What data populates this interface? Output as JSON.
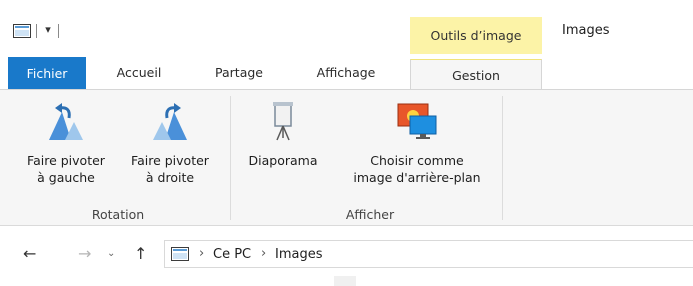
{
  "window": {
    "title": "Images"
  },
  "quick_access": {
    "dropdown_glyph": "▾",
    "icon": "folder-properties-icon"
  },
  "context_group": {
    "label": "Outils d’image",
    "color": "#fcf3a7"
  },
  "tabs": [
    {
      "label": "Fichier",
      "active": false,
      "accent": "#1979ca"
    },
    {
      "label": "Accueil"
    },
    {
      "label": "Partage"
    },
    {
      "label": "Affichage"
    },
    {
      "label": "Gestion",
      "active": true
    }
  ],
  "ribbon": {
    "groups": {
      "rotation": {
        "label": "Rotation",
        "commands": {
          "rotate_left": {
            "line1": "Faire pivoter",
            "line2": "à gauche",
            "icon": "rotate-left-icon"
          },
          "rotate_right": {
            "line1": "Faire pivoter",
            "line2": "à droite",
            "icon": "rotate-right-icon"
          }
        }
      },
      "afficher": {
        "label": "Afficher",
        "commands": {
          "slideshow": {
            "line1": "Diaporama",
            "icon": "slideshow-icon"
          },
          "set_background": {
            "line1": "Choisir comme",
            "line2": "image d'arrière-plan",
            "icon": "set-background-icon"
          }
        }
      }
    }
  },
  "nav": {
    "back_glyph": "←",
    "forward_glyph": "→",
    "recent_glyph": "⌄",
    "up_glyph": "↑",
    "breadcrumb": [
      "Ce PC",
      "Images"
    ],
    "separator": "›"
  }
}
